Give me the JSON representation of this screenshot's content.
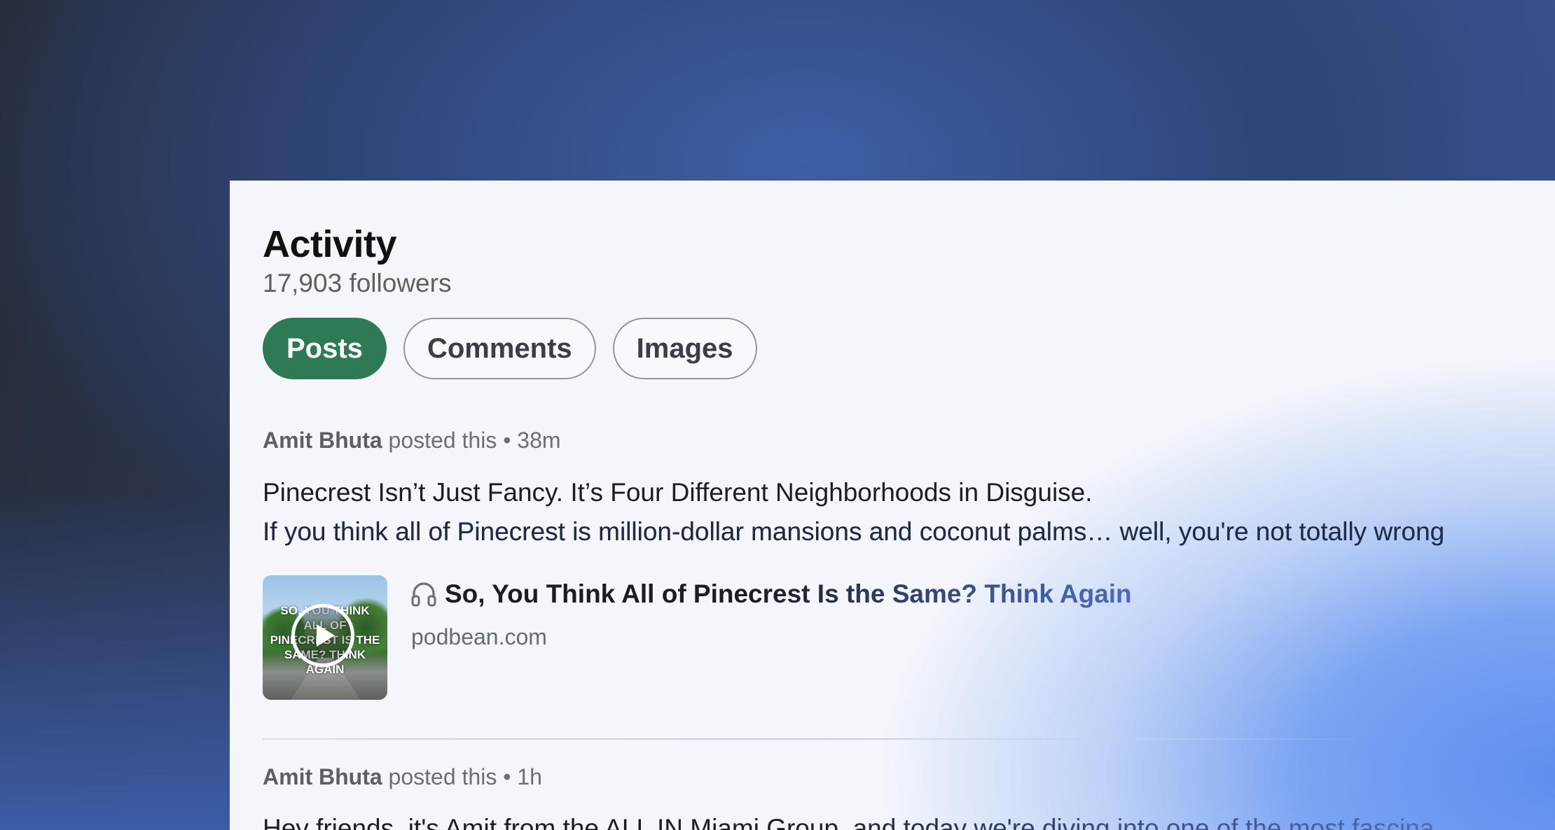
{
  "activity": {
    "title": "Activity",
    "followers": "17,903 followers"
  },
  "tabs": [
    {
      "label": "Posts",
      "active": true
    },
    {
      "label": "Comments",
      "active": false
    },
    {
      "label": "Images",
      "active": false
    }
  ],
  "posts": [
    {
      "author": "Amit Bhuta",
      "action": " posted this",
      "separator": " • ",
      "time": "38m",
      "line1": "Pinecrest Isn’t Just Fancy. It’s Four Different Neighborhoods in Disguise.",
      "line2": "If you think all of Pinecrest is million-dollar mansions and coconut palms… well, you're not totally wrong",
      "attachment": {
        "icon": "headphones-icon",
        "title": "So, You Think All of Pinecrest Is the Same? Think Again",
        "source": "podbean.com",
        "thumbnail_text": "SO, YOU THINK ALL OF PINECREST IS THE SAME? THINK AGAIN"
      }
    },
    {
      "author": "Amit Bhuta",
      "action": " posted this",
      "separator": " • ",
      "time": "1h",
      "line1": "Hey friends, it's Amit from the ALL IN Miami Group, and today we're diving into one of the most fascina"
    }
  ],
  "colors": {
    "accent_green": "#2e7a55",
    "card_background": "#f4f6fb",
    "page_background": "#2f4577"
  }
}
